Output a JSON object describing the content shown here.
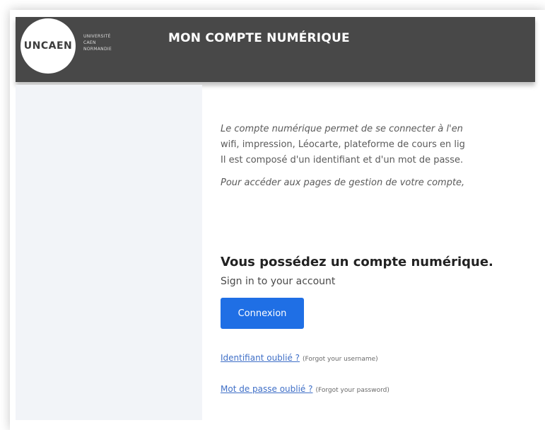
{
  "header": {
    "logo_text": "UNCAEN",
    "logo_sub_lines": [
      "UNIVERSITÉ",
      "CAEN",
      "NORMANDIE"
    ],
    "title": "MON COMPTE NUMÉRIQUE"
  },
  "main": {
    "intro_line1": "Le compte numérique permet de se connecter à l'en",
    "intro_line2": "wifi, impression, Léocarte, plateforme de cours en lig",
    "intro_line3": "Il est composé d'un identifiant et d'un mot de passe.",
    "access_line": "Pour accéder aux pages de gestion de votre compte,",
    "heading": "Vous possédez un compte numérique.",
    "subheading": "Sign in to your account",
    "connexion_button": "Connexion",
    "forgot_username_link": "Identifiant oublié ?",
    "forgot_username_hint": "(Forgot your username)",
    "forgot_password_link": "Mot de passe oublié ?",
    "forgot_password_hint": "(Forgot your password)"
  },
  "colors": {
    "header_bg": "#484848",
    "sidebar_bg": "#f2f4f8",
    "button_bg": "#1f6fe5",
    "link": "#3f6fc7"
  }
}
